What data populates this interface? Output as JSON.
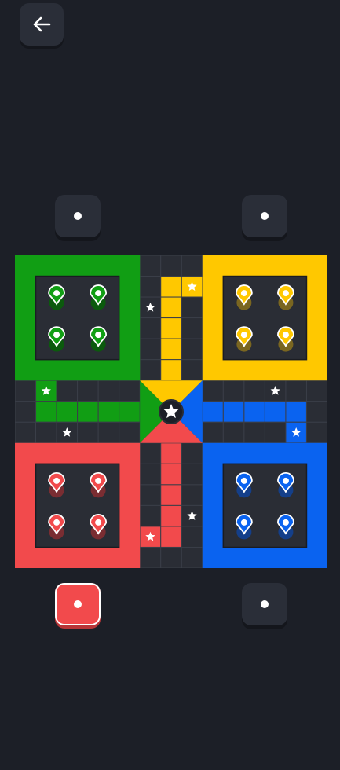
{
  "colors": {
    "background": "#1c1f27",
    "grid": "#2a2d35",
    "grid_line": "#3a3e48",
    "green": "#119e14",
    "yellow": "#ffc800",
    "red": "#f24a4c",
    "blue": "#0a63f0",
    "star": "#ffffff"
  },
  "header": {
    "back_icon": "arrow-left-icon"
  },
  "dice": {
    "top_left": {
      "value": 1,
      "active": false
    },
    "top_right": {
      "value": 1,
      "active": false
    },
    "bottom_left": {
      "value": 1,
      "active": true
    },
    "bottom_right": {
      "value": 1,
      "active": false
    }
  },
  "players": [
    {
      "color": "green",
      "home": "top-left",
      "tokens_in_base": 4
    },
    {
      "color": "yellow",
      "home": "top-right",
      "tokens_in_base": 4
    },
    {
      "color": "red",
      "home": "bottom-left",
      "tokens_in_base": 4
    },
    {
      "color": "blue",
      "home": "bottom-right",
      "tokens_in_base": 4
    }
  ],
  "center_icon": "star-icon"
}
